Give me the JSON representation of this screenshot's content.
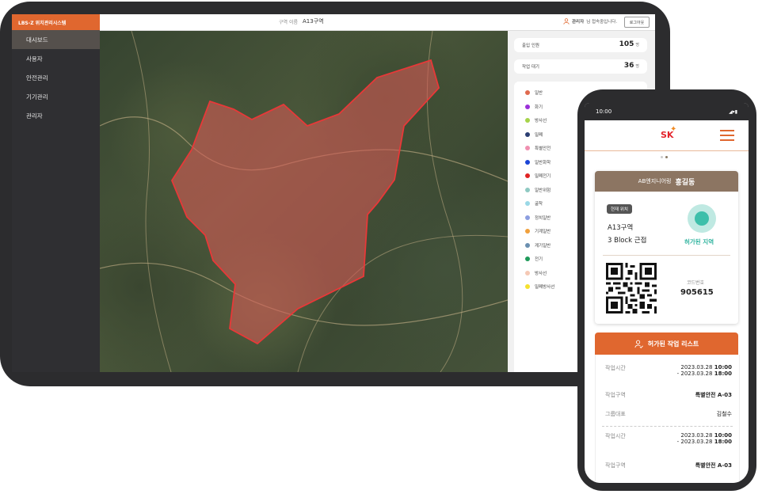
{
  "tablet": {
    "brand": "LBS-Z 위치관리시스템",
    "menu": [
      {
        "label": "대시보드",
        "active": true
      },
      {
        "label": "사용자"
      },
      {
        "label": "안전관리"
      },
      {
        "label": "기기관리"
      },
      {
        "label": "관리자"
      }
    ],
    "topbar": {
      "area_label": "구역 이름",
      "area_value": "A13구역",
      "admin_name": "관리자",
      "admin_suffix": "님 접속중입니다.",
      "logout_label": "로그아웃"
    },
    "stats": [
      {
        "label": "출입 인원",
        "value": "105",
        "unit": "명"
      },
      {
        "label": "작업 대기",
        "value": "36",
        "unit": "명"
      }
    ],
    "legend": [
      {
        "label": "일반",
        "color": "#e06a4f"
      },
      {
        "label": "화기",
        "color": "#9b30d9"
      },
      {
        "label": "방사선",
        "color": "#a6d34a"
      },
      {
        "label": "밀폐",
        "color": "#2b3e72"
      },
      {
        "label": "특별안전",
        "color": "#f08fb0"
      },
      {
        "label": "일반화학",
        "color": "#1a44d6"
      },
      {
        "label": "밀폐전기",
        "color": "#e02424"
      },
      {
        "label": "일반위험",
        "color": "#8fc9c2"
      },
      {
        "label": "굴착",
        "color": "#9ad8e6"
      },
      {
        "label": "정치일반",
        "color": "#8c9ee0"
      },
      {
        "label": "기계일반",
        "color": "#f0a03c"
      },
      {
        "label": "계기일반",
        "color": "#6a8fb0"
      },
      {
        "label": "전기",
        "color": "#1e9a5a"
      },
      {
        "label": "방사선",
        "color": "#f5c9b5"
      },
      {
        "label": "밀폐방사선",
        "color": "#f5e12e"
      }
    ]
  },
  "phone": {
    "time": "10:00",
    "status_icons": "◢▾▮",
    "logo": "SK",
    "company": "AB엔지니어링",
    "worker": "홍길동",
    "loc_badge": "현재 위치",
    "loc_line1": "A13구역",
    "loc_line2": "3 Block 근접",
    "allowed_label": "허가된 지역",
    "code_label": "코드번호",
    "code_value": "905615",
    "work_list_title": "허가된 작업 리스트",
    "works": [
      {
        "time_label": "작업시간",
        "start_date": "2023.03.28",
        "start_time": "10:00",
        "end_date": "- 2023.03.28",
        "end_time": "18:00",
        "area_label": "작업구역",
        "area": "특별안전 A-03",
        "rep_label": "그룹대표",
        "rep": "김철수"
      },
      {
        "time_label": "작업시간",
        "start_date": "2023.03.28",
        "start_time": "10:00",
        "end_date": "- 2023.03.28",
        "end_time": "18:00",
        "area_label": "작업구역",
        "area": "특별안전 A-03"
      }
    ]
  }
}
